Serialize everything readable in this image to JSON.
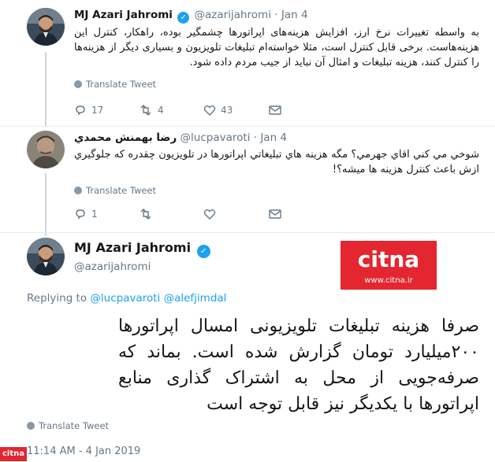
{
  "tweet1": {
    "name": "MJ Azari Jahromi",
    "handle": "@azarijahromi",
    "date": "Jan 4",
    "text": "به واسطه تغییرات نرخ ارز، افزایش هزینه‌های اپراتورها چشمگیر بوده، راهکار، کنترل این هزینه‌هاست. برخی قابل کنترل است، مثلا خواسته‌ام تبلیغات تلویزیون و بسیاری دیگر از هزینه‌ها را کنترل کنند، هزینه تبلیغات و امثال آن نباید از جیب مردم داده شود.",
    "translate": "Translate Tweet",
    "replies": "17",
    "retweets": "4",
    "likes": "43"
  },
  "tweet2": {
    "name": "رضا بهمنش محمدي",
    "handle": "@lucpavaroti",
    "date": "Jan 4",
    "text": "شوخي مي كني اقاي جهرمي؟ مگه هزينه هاي تبليغاتي اپراتورها در تلويزيون چقدره كه جلوگيري ازش باعث كنترل هزينه ها ميشه؟!",
    "translate": "Translate Tweet",
    "replies": "1",
    "retweets": "",
    "likes": ""
  },
  "main_tweet": {
    "name": "MJ Azari Jahromi",
    "handle": "@azarijahromi",
    "replying_prefix": "Replying to",
    "replying_to": "@lucpavaroti @alefjimdal",
    "text": "صرفا هزینه تبلیغات تلویزیونی امسال اپراتورها ۲۰۰میلیارد تومان گزارش شده است. بماند که صرفه‌جویی از محل به اشتراک گذاری منابع اپراتورها با یکدیگر نیز قابل توجه است",
    "translate": "Translate Tweet",
    "timestamp": "11:14 AM - 4 Jan 2019"
  },
  "logo": {
    "brand": "citna",
    "url": "www.citna.ir"
  },
  "watermark": "citna",
  "colors": {
    "accent": "#1da1f2",
    "muted": "#657786",
    "logo_red": "#e3262f"
  }
}
